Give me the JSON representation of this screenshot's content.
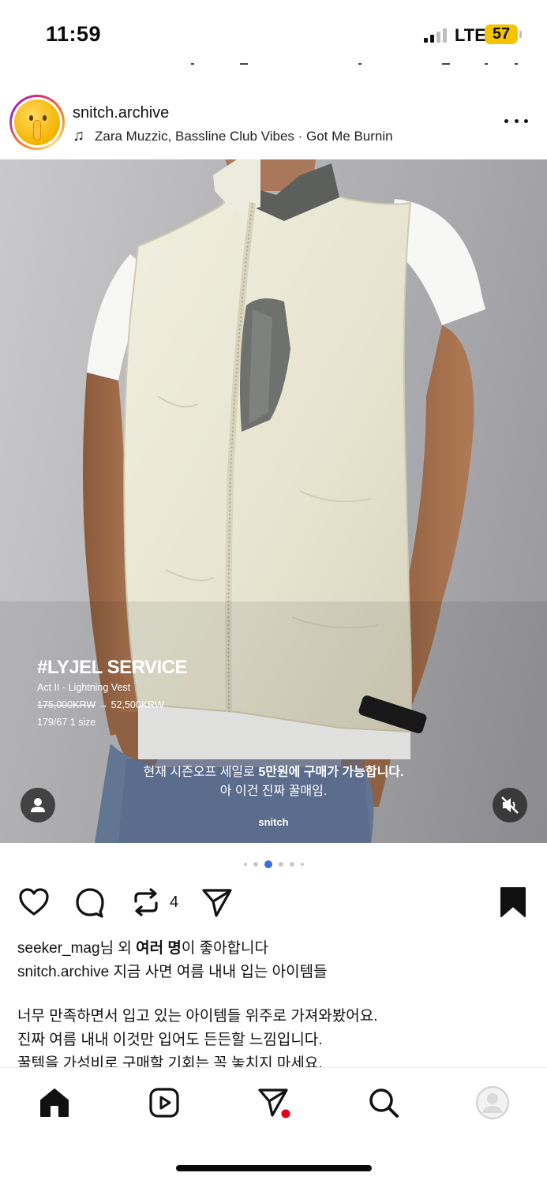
{
  "status_bar": {
    "time": "11:59",
    "network": "LTE",
    "battery": "57",
    "battery_color": "#f5c400"
  },
  "post": {
    "username": "snitch.archive",
    "avatar_icon": "shushing-face-emoji",
    "music_icon": "music-note-icon",
    "music": "Zara Muzzic, Bassline Club Vibes · Got Me Burnin",
    "more_icon": "more-options-icon"
  },
  "media": {
    "title": "#LYJEL SERVICE",
    "product": "Act II - Lightning Vest",
    "price_old": "175,000KRW",
    "price_arrow": "→",
    "price_new": "52,500KRW",
    "size": "179/67 1 size",
    "caption_line1_plain": "현재 시즌오프 세일로 ",
    "caption_line1_bold": "5만원에 구매가 가능합니다.",
    "caption_line2": "아 이건 진짜 꿀매임.",
    "watermark": "snitch",
    "carousel_total": 6,
    "carousel_active_index": 2,
    "accent_color": "#3c6fe0"
  },
  "actions": {
    "like_icon": "heart-icon",
    "comment_icon": "comment-icon",
    "repost_icon": "repost-icon",
    "repost_count": "4",
    "share_icon": "send-icon",
    "save_icon": "bookmark-icon"
  },
  "likes": {
    "user": "seeker_mag",
    "text_mid": "님 외 ",
    "others": "여러 명",
    "text_end": "이 좋아합니다"
  },
  "caption": {
    "username": "snitch.archive",
    "text": " 지금 사면 여름 내내 입는 아이템들",
    "lines": [
      "너무 만족하면서 입고 있는 아이템들 위주로 가져와봤어요.",
      "진짜 여름 내내 이것만 입어도 든든할 느낌입니다.",
      "꿀템을 가성비로 구매할 기회는 꼭 놓치지 마세요."
    ]
  },
  "nav": {
    "items": [
      "home-icon",
      "reels-icon",
      "direct-icon",
      "search-icon",
      "profile-icon"
    ],
    "notification_color": "#e0001b"
  }
}
